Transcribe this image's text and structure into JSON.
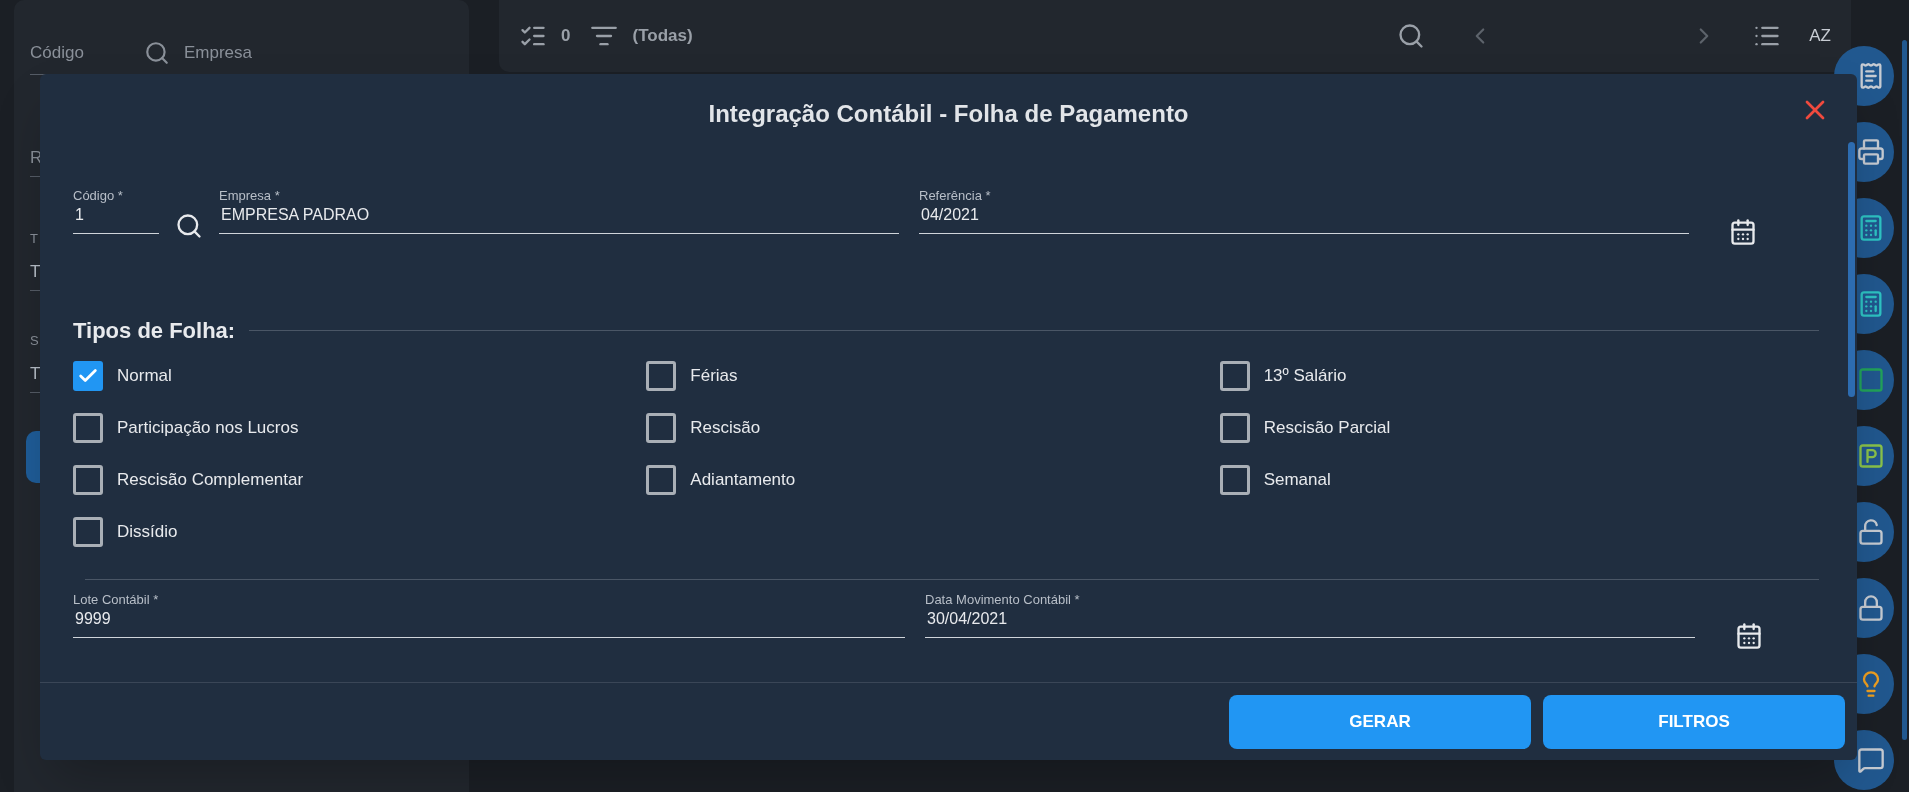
{
  "background": {
    "left_panel": {
      "fields": [
        {
          "label": "Código"
        },
        {
          "label": "Empresa"
        }
      ],
      "partial_labels": [
        "R",
        "T",
        "T",
        "S",
        "T"
      ]
    },
    "toolbar": {
      "count": "0",
      "filter": "(Todas)",
      "sort": "AZ"
    }
  },
  "dialog": {
    "title": "Integração Contábil - Folha de Pagamento",
    "top_fields": [
      {
        "label": "Código *",
        "value": "1"
      },
      {
        "label": "Empresa *",
        "value": "EMPRESA PADRAO"
      },
      {
        "label": "Referência *",
        "value": "04/2021"
      }
    ],
    "section_title": "Tipos de Folha:",
    "checkboxes": [
      {
        "label": "Normal",
        "checked": true
      },
      {
        "label": "Férias",
        "checked": false
      },
      {
        "label": "13º Salário",
        "checked": false
      },
      {
        "label": "Participação nos Lucros",
        "checked": false
      },
      {
        "label": "Rescisão",
        "checked": false
      },
      {
        "label": "Rescisão Parcial",
        "checked": false
      },
      {
        "label": "Rescisão Complementar",
        "checked": false
      },
      {
        "label": "Adiantamento",
        "checked": false
      },
      {
        "label": "Semanal",
        "checked": false
      },
      {
        "label": "Dissídio",
        "checked": false
      }
    ],
    "bottom_fields": [
      {
        "label": "Lote Contábil *",
        "value": "9999"
      },
      {
        "label": "Data Movimento Contábil *",
        "value": "30/04/2021"
      }
    ],
    "buttons": [
      "GERAR",
      "FILTROS"
    ]
  }
}
